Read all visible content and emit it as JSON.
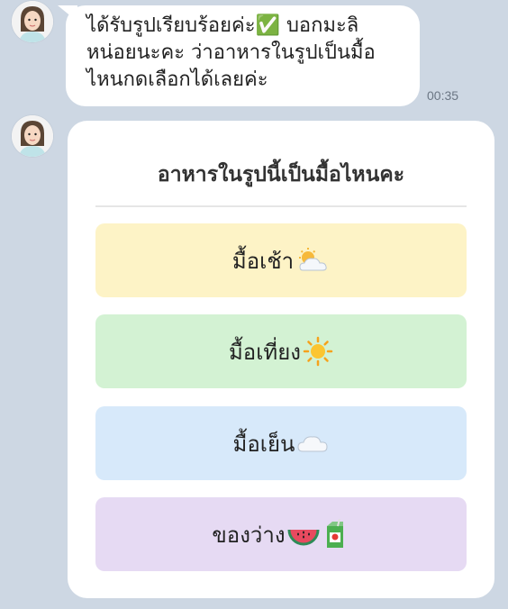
{
  "message": {
    "text": "ได้รับรูปเรียบร้อยค่ะ✅ บอกมะลิ\nหน่อยนะคะ ว่าอาหารในรูปเป็นมื้อ\nไหนกดเลือกได้เลยค่ะ",
    "time": "00:35"
  },
  "card": {
    "title": "อาหารในรูปนี้เป็นมื้อไหนคะ",
    "options": [
      {
        "label": "มื้อเช้า",
        "icon": "sun-behind-cloud-icon",
        "color": "#fdf3c6"
      },
      {
        "label": "มื้อเที่ยง",
        "icon": "sun-icon",
        "color": "#d3f2d3"
      },
      {
        "label": "มื้อเย็น",
        "icon": "cloud-icon",
        "color": "#d7e9fa"
      },
      {
        "label": "ของว่าง",
        "icon": "watermelon-and-juice-box-icon",
        "color": "#e6daf3"
      }
    ]
  },
  "colors": {
    "background": "#cdd7e3",
    "bubble": "#ffffff"
  }
}
